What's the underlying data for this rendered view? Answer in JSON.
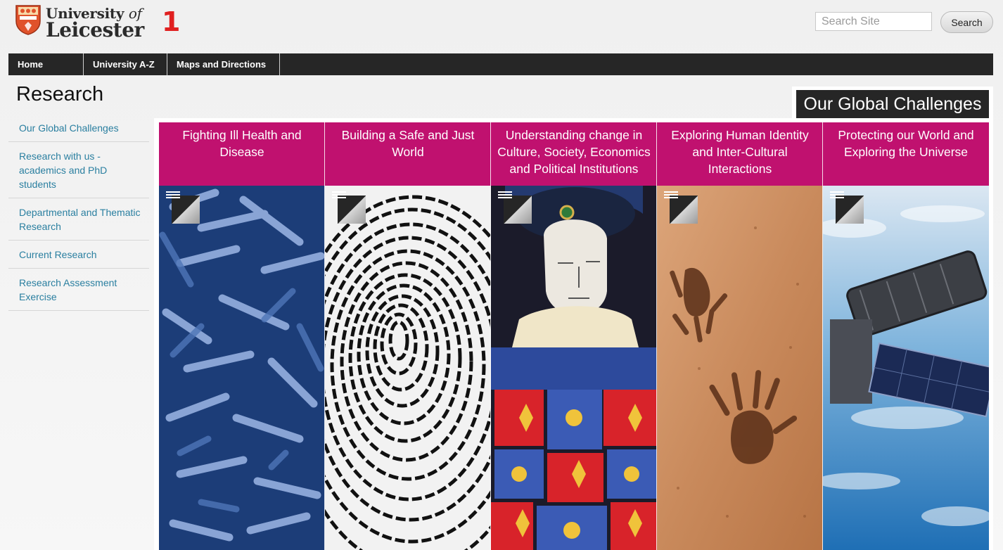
{
  "header": {
    "logo_line1_a": "University",
    "logo_line1_b": "of",
    "logo_line2": "Leicester",
    "annotation_number": "1",
    "search_placeholder": "Search Site",
    "search_button": "Search"
  },
  "nav": {
    "items": [
      {
        "label": "Home"
      },
      {
        "label": "University A-Z"
      },
      {
        "label": "Maps and Directions"
      }
    ]
  },
  "page": {
    "title": "Research"
  },
  "sidebar": {
    "items": [
      {
        "label": "Our Global Challenges"
      },
      {
        "label": "Research with us - academics and PhD students"
      },
      {
        "label": "Departmental and Thematic Research"
      },
      {
        "label": "Current Research"
      },
      {
        "label": "Research Assessment Exercise"
      }
    ]
  },
  "challenges": {
    "heading": "Our Global Challenges",
    "tiles": [
      {
        "title": "Fighting Ill Health and Disease",
        "image_icon": "bacteria-image"
      },
      {
        "title": "Building a Safe and Just World",
        "image_icon": "fingerprint-image"
      },
      {
        "title": "Understanding change in Culture, Society, Economics and Political Institutions",
        "image_icon": "stained-glass-image"
      },
      {
        "title": "Exploring Human Identity and Inter-Cultural Interactions",
        "image_icon": "handprints-image"
      },
      {
        "title": "Protecting our World and Exploring the Universe",
        "image_icon": "satellite-image"
      }
    ]
  },
  "colors": {
    "accent": "#c0116f",
    "nav_bg": "#262626",
    "link": "#2a7fa0",
    "marker": "#e02020"
  }
}
